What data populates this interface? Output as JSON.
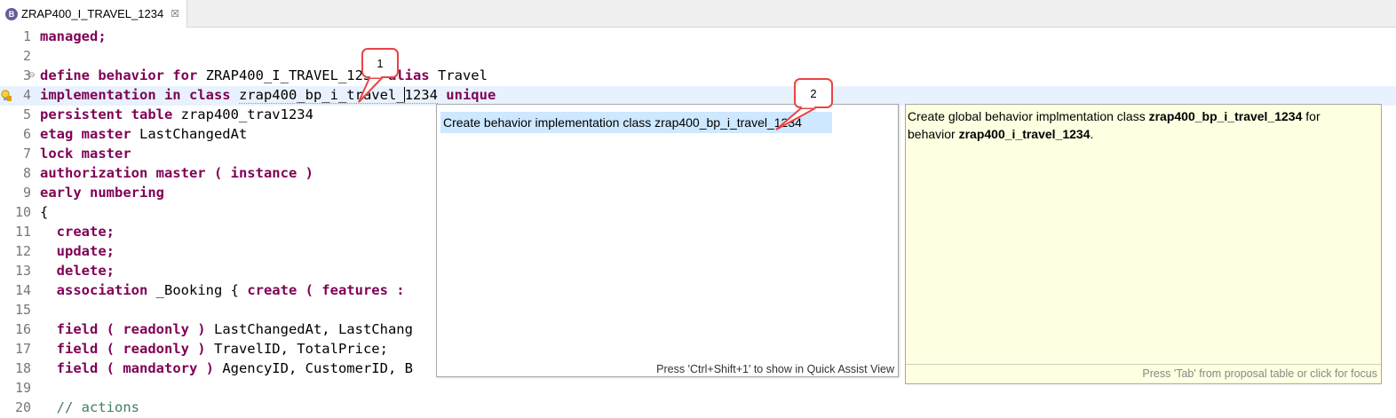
{
  "tab": {
    "title": "ZRAP400_I_TRAVEL_1234",
    "icon": "B",
    "close": "☒"
  },
  "lines": [
    {
      "num": "1",
      "parts": [
        [
          "kw",
          "managed;"
        ]
      ]
    },
    {
      "num": "2",
      "parts": []
    },
    {
      "num": "3",
      "fold": "⊖",
      "parts": [
        [
          "kw",
          "define behavior for "
        ],
        [
          "t",
          "ZRAP400_I_TRAVEL_1234 "
        ],
        [
          "kw",
          "alias "
        ],
        [
          "t",
          "Travel"
        ]
      ]
    },
    {
      "num": "4",
      "current": true,
      "bulb": true,
      "parts": [
        [
          "kw",
          "implementation in class "
        ],
        [
          "sq",
          "zrap400_bp_i_travel_"
        ],
        [
          "caret",
          ""
        ],
        [
          "sq",
          "1234"
        ],
        [
          "t",
          " "
        ],
        [
          "kw",
          "unique"
        ]
      ]
    },
    {
      "num": "5",
      "parts": [
        [
          "kw",
          "persistent table "
        ],
        [
          "t",
          "zrap400_trav1234"
        ]
      ]
    },
    {
      "num": "6",
      "parts": [
        [
          "kw",
          "etag master "
        ],
        [
          "t",
          "LastChangedAt"
        ]
      ]
    },
    {
      "num": "7",
      "parts": [
        [
          "kw",
          "lock master"
        ]
      ]
    },
    {
      "num": "8",
      "parts": [
        [
          "kw",
          "authorization master ( instance )"
        ]
      ]
    },
    {
      "num": "9",
      "parts": [
        [
          "kw",
          "early numbering"
        ]
      ]
    },
    {
      "num": "10",
      "parts": [
        [
          "t",
          "{"
        ]
      ]
    },
    {
      "num": "11",
      "parts": [
        [
          "t",
          "  "
        ],
        [
          "kw",
          "create;"
        ]
      ]
    },
    {
      "num": "12",
      "parts": [
        [
          "t",
          "  "
        ],
        [
          "kw",
          "update;"
        ]
      ]
    },
    {
      "num": "13",
      "parts": [
        [
          "t",
          "  "
        ],
        [
          "kw",
          "delete;"
        ]
      ]
    },
    {
      "num": "14",
      "parts": [
        [
          "t",
          "  "
        ],
        [
          "kw",
          "association "
        ],
        [
          "t",
          "_Booking { "
        ],
        [
          "kw",
          "create ( features :"
        ]
      ]
    },
    {
      "num": "15",
      "parts": []
    },
    {
      "num": "16",
      "parts": [
        [
          "t",
          "  "
        ],
        [
          "kw",
          "field ( readonly ) "
        ],
        [
          "t",
          "LastChangedAt, LastChang"
        ]
      ]
    },
    {
      "num": "17",
      "parts": [
        [
          "t",
          "  "
        ],
        [
          "kw",
          "field ( readonly ) "
        ],
        [
          "t",
          "TravelID, TotalPrice;"
        ]
      ]
    },
    {
      "num": "18",
      "parts": [
        [
          "t",
          "  "
        ],
        [
          "kw",
          "field ( mandatory ) "
        ],
        [
          "t",
          "AgencyID, CustomerID, B"
        ]
      ]
    },
    {
      "num": "19",
      "parts": []
    },
    {
      "num": "20",
      "parts": [
        [
          "t",
          "  "
        ],
        [
          "cm",
          "// actions"
        ]
      ]
    }
  ],
  "quick_assist": {
    "proposal": "Create behavior implementation class zrap400_bp_i_travel_1234",
    "footer": "Press 'Ctrl+Shift+1' to show in Quick Assist View"
  },
  "info_popup": {
    "t1": "Create global behavior implmentation class ",
    "b1": "zrap400_bp_i_travel_1234",
    "t2": " for",
    "t3": " behavior ",
    "b2": "zrap400_i_travel_1234",
    "t4": ".",
    "footer": "Press 'Tab' from proposal table or click for focus"
  },
  "callouts": {
    "first": "1",
    "second": "2"
  },
  "colors": {
    "keyword": "#7f0055",
    "callout": "#e84545",
    "selection": "#cde8ff",
    "info_bg": "#ffffe1"
  }
}
